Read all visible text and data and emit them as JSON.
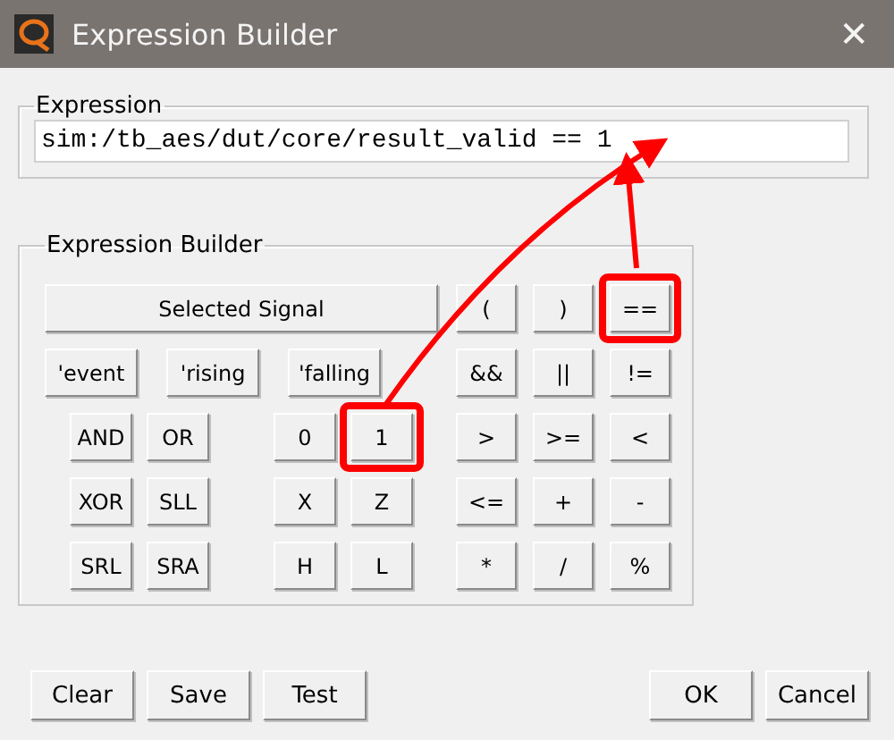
{
  "window": {
    "title": "Expression Builder",
    "close": "✕"
  },
  "expression": {
    "title": "Expression",
    "value": "sim:/tb_aes/dut/core/result_valid == 1"
  },
  "builder": {
    "title": "Expression Builder",
    "signal_button": {
      "label": "Selected Signal",
      "highlighted": false
    },
    "attribute_buttons": [
      {
        "label": "'event",
        "highlighted": false
      },
      {
        "label": "'rising",
        "highlighted": false
      },
      {
        "label": "'falling",
        "highlighted": false
      }
    ],
    "logic_buttons": [
      [
        {
          "label": "AND",
          "highlighted": false
        },
        {
          "label": "OR",
          "highlighted": false
        }
      ],
      [
        {
          "label": "XOR",
          "highlighted": false
        },
        {
          "label": "SLL",
          "highlighted": false
        }
      ],
      [
        {
          "label": "SRL",
          "highlighted": false
        },
        {
          "label": "SRA",
          "highlighted": false
        }
      ]
    ],
    "value_buttons": [
      [
        {
          "label": "0",
          "highlighted": false
        },
        {
          "label": "1",
          "highlighted": true
        }
      ],
      [
        {
          "label": "X",
          "highlighted": false
        },
        {
          "label": "Z",
          "highlighted": false
        }
      ],
      [
        {
          "label": "H",
          "highlighted": false
        },
        {
          "label": "L",
          "highlighted": false
        }
      ]
    ],
    "operator_buttons": [
      [
        {
          "label": "(",
          "highlighted": false
        },
        {
          "label": ")",
          "highlighted": false
        },
        {
          "label": "==",
          "highlighted": true
        }
      ],
      [
        {
          "label": "&&",
          "highlighted": false
        },
        {
          "label": "||",
          "highlighted": false
        },
        {
          "label": "!=",
          "highlighted": false
        }
      ],
      [
        {
          "label": ">",
          "highlighted": false
        },
        {
          "label": ">=",
          "highlighted": false
        },
        {
          "label": "<",
          "highlighted": false
        }
      ],
      [
        {
          "label": "<=",
          "highlighted": false
        },
        {
          "label": "+",
          "highlighted": false
        },
        {
          "label": "-",
          "highlighted": false
        }
      ],
      [
        {
          "label": "*",
          "highlighted": false
        },
        {
          "label": "/",
          "highlighted": false
        },
        {
          "label": "%",
          "highlighted": false
        }
      ]
    ]
  },
  "left_buttons": [
    "Clear",
    "Save",
    "Test"
  ],
  "right_buttons": [
    "OK",
    "Cancel"
  ]
}
